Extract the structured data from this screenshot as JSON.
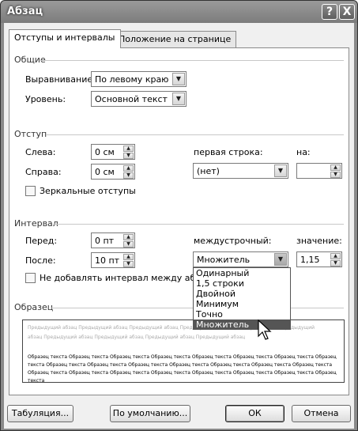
{
  "window": {
    "title": "Абзац",
    "help_label": "?",
    "close_label": "X"
  },
  "tabs": [
    {
      "label": "Отступы и интервалы"
    },
    {
      "label": "Положение на странице"
    }
  ],
  "general": {
    "title": "Общие",
    "alignment_label": "Выравнивание:",
    "alignment_value": "По левому краю",
    "level_label": "Уровень:",
    "level_value": "Основной текст"
  },
  "indent": {
    "title": "Отступ",
    "left_label": "Слева:",
    "left_value": "0 см",
    "right_label": "Справа:",
    "right_value": "0 см",
    "first_line_label": "первая строка:",
    "first_line_value": "(нет)",
    "by_label": "на:",
    "by_value": "",
    "mirror_label": "Зеркальные отступы"
  },
  "spacing": {
    "title": "Интервал",
    "before_label": "Перед:",
    "before_value": "0 пт",
    "after_label": "После:",
    "after_value": "10 пт",
    "line_spacing_label": "междустрочный:",
    "line_spacing_value": "Множитель",
    "at_label": "значение:",
    "at_value": "1,15",
    "no_space_label": "Не добавлять интервал между абзацами",
    "options": [
      "Одинарный",
      "1,5 строки",
      "Двойной",
      "Минимум",
      "Точно",
      "Множитель"
    ],
    "selected_option": "Множитель"
  },
  "preview": {
    "title": "Образец",
    "previous_text": "Предыдущий абзац Предыдущий абзац Предыдущий абзац Предыдущий абзац Предыдущий абзац Предыдущий абзац Предыдущий абзац Предыдущий абзац Предыдущий абзац Предыдущий абзац",
    "sample_text": "Образец текста Образец текста Образец текста Образец текста Образец текста Образец текста Образец текста Образец текста Образец текста Образец текста Образец текста Образец текста Образец текста Образец текста Образец текста Образец текста Образец текста Образец текста Образец текста Образец текста Образец текста Образец текста Образец текста"
  },
  "buttons": {
    "tabs_label": "Табуляция...",
    "default_label": "По умолчанию...",
    "ok_label": "ОК",
    "cancel_label": "Отмена"
  }
}
